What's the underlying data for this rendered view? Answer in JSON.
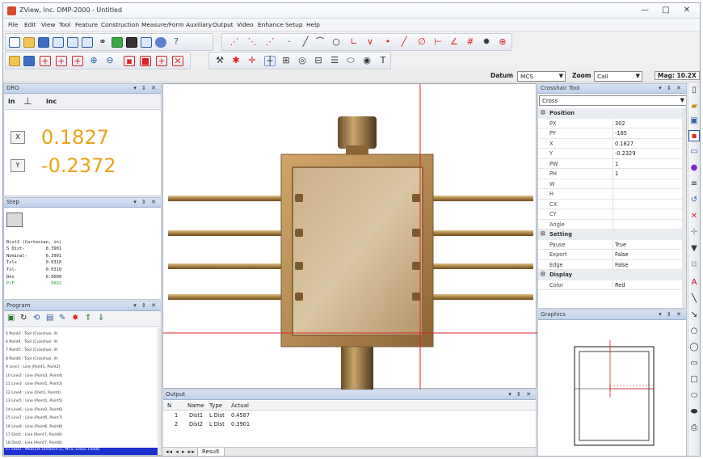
{
  "window": {
    "title": "ZView, Inc. DMP-2000 - Untitled",
    "btn_min": "—",
    "btn_max": "□",
    "btn_close": "✕"
  },
  "menu": [
    "File",
    "Edit",
    "View",
    "Tool",
    "Feature",
    "Construction",
    "Measure/Form",
    "Auxiliary",
    "Output",
    "Video",
    "Enhance",
    "Setup",
    "Help"
  ],
  "status": {
    "datum_label": "Datum",
    "datum_value": "MCS",
    "zoom_label": "Zoom",
    "zoom_value": "Call",
    "mag_label": "Mag: 10.2X"
  },
  "dro": {
    "title": "DRO",
    "units_left": "in",
    "units_right": "inc",
    "x_label": "X",
    "x_value": "0.1827",
    "y_label": "Y",
    "y_value": "-0.2372"
  },
  "step": {
    "title": "Step",
    "lines": [
      "Dist2 (Cartesian, in)",
      "S Dist-        0.3901",
      "Nominal-       0.3901",
      "Tol+           0.0310",
      "Tol-           0.0310",
      "Dev            0.0000",
      "P/F              PASS"
    ]
  },
  "program": {
    "title": "Program",
    "items": [
      "5  Point3 : Tool (Crosshair, 9)",
      "6  Point4 : Tool (Crosshair, 9)",
      "7  Point5 : Tool (Crosshair, 9)",
      "8  Point6 : Tool (Crosshair, 9)",
      "9  Line1 : Line (Point1, Point2)",
      "10 Line2 : Line (Point3, Point4)",
      "11 Line3 : Line (Point1, Point3)",
      "12 Line4 : Line (Dist2, Point4)",
      "13 Line5 : Line (Point1, Point5)",
      "14 Line6 : Line (Point2, Point6)",
      "15 Line7 : Line (Point5, Point7)",
      "16 Line8 : Line (Point6, Point8)",
      "17 Dist1 : Line (Point7, Point8)",
      "18 Dist2 : Line (Point7, Point8)",
      "17 Dist2 : Measure Distance (L, MCS, Line2, Line4)"
    ]
  },
  "output": {
    "title": "Output",
    "columns": [
      "N",
      "Name",
      "Type",
      "Actual"
    ],
    "rows": [
      [
        "1",
        "Dist1",
        "L Dist",
        "0.4587"
      ],
      [
        "2",
        "Dist2",
        "L Dist",
        "0.3901"
      ]
    ],
    "tab": "Result"
  },
  "crosshair": {
    "title": "Crosshair Tool",
    "select_value": "Cross",
    "sections": {
      "position": "Position",
      "setting": "Setting",
      "display": "Display"
    },
    "position_rows": [
      [
        "PX",
        "302"
      ],
      [
        "PY",
        "-185"
      ],
      [
        "X",
        "0.1827"
      ],
      [
        "Y",
        "-0.2329"
      ],
      [
        "PW",
        "1"
      ],
      [
        "PH",
        "1"
      ],
      [
        "W",
        ""
      ],
      [
        "H",
        ""
      ],
      [
        "CX",
        ""
      ],
      [
        "CY",
        ""
      ],
      [
        "Angle",
        ""
      ]
    ],
    "setting_rows": [
      [
        "Pause",
        "True"
      ],
      [
        "Export",
        "False"
      ],
      [
        "Edge",
        "False"
      ]
    ],
    "display_rows": [
      [
        "Color",
        "Red"
      ]
    ]
  },
  "graphics": {
    "title": "Graphics"
  },
  "colors": {
    "dro_value": "#e8a318",
    "accent_red": "#d9262c",
    "panel_header": "#c9d8ee",
    "selection": "#1c2fcf"
  }
}
